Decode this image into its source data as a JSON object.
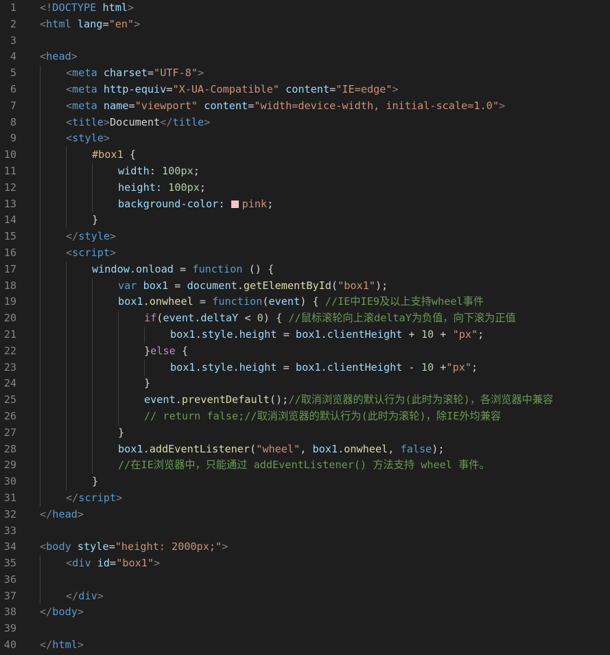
{
  "editor": {
    "background": "#1e1e1e",
    "lines": [
      {
        "n": "1",
        "indent": 0,
        "guides": [],
        "tokens": [
          {
            "t": "<!",
            "c": "punct"
          },
          {
            "t": "DOCTYPE",
            "c": "doctype"
          },
          {
            "t": " html",
            "c": "attr"
          },
          {
            "t": ">",
            "c": "punct"
          }
        ]
      },
      {
        "n": "2",
        "indent": 0,
        "guides": [],
        "tokens": [
          {
            "t": "<",
            "c": "punct"
          },
          {
            "t": "html",
            "c": "tag"
          },
          {
            "t": " lang",
            "c": "attr"
          },
          {
            "t": "=",
            "c": "text"
          },
          {
            "t": "\"en\"",
            "c": "str"
          },
          {
            "t": ">",
            "c": "punct"
          }
        ]
      },
      {
        "n": "3",
        "indent": 0,
        "guides": [],
        "tokens": []
      },
      {
        "n": "4",
        "indent": 0,
        "guides": [],
        "tokens": [
          {
            "t": "<",
            "c": "punct"
          },
          {
            "t": "head",
            "c": "tag"
          },
          {
            "t": ">",
            "c": "punct"
          }
        ]
      },
      {
        "n": "5",
        "indent": 1,
        "guides": [
          0
        ],
        "tokens": [
          {
            "t": "<",
            "c": "punct"
          },
          {
            "t": "meta",
            "c": "tag"
          },
          {
            "t": " charset",
            "c": "attr"
          },
          {
            "t": "=",
            "c": "text"
          },
          {
            "t": "\"UTF-8\"",
            "c": "str"
          },
          {
            "t": ">",
            "c": "punct"
          }
        ]
      },
      {
        "n": "6",
        "indent": 1,
        "guides": [
          0
        ],
        "tokens": [
          {
            "t": "<",
            "c": "punct"
          },
          {
            "t": "meta",
            "c": "tag"
          },
          {
            "t": " http-equiv",
            "c": "attr"
          },
          {
            "t": "=",
            "c": "text"
          },
          {
            "t": "\"X-UA-Compatible\"",
            "c": "str"
          },
          {
            "t": " content",
            "c": "attr"
          },
          {
            "t": "=",
            "c": "text"
          },
          {
            "t": "\"IE=edge\"",
            "c": "str"
          },
          {
            "t": ">",
            "c": "punct"
          }
        ]
      },
      {
        "n": "7",
        "indent": 1,
        "guides": [
          0
        ],
        "tokens": [
          {
            "t": "<",
            "c": "punct"
          },
          {
            "t": "meta",
            "c": "tag"
          },
          {
            "t": " name",
            "c": "attr"
          },
          {
            "t": "=",
            "c": "text"
          },
          {
            "t": "\"viewport\"",
            "c": "str"
          },
          {
            "t": " content",
            "c": "attr"
          },
          {
            "t": "=",
            "c": "text"
          },
          {
            "t": "\"width=device-width, initial-scale=1.0\"",
            "c": "str"
          },
          {
            "t": ">",
            "c": "punct"
          }
        ]
      },
      {
        "n": "8",
        "indent": 1,
        "guides": [
          0
        ],
        "tokens": [
          {
            "t": "<",
            "c": "punct"
          },
          {
            "t": "title",
            "c": "tag"
          },
          {
            "t": ">",
            "c": "punct"
          },
          {
            "t": "Document",
            "c": "text"
          },
          {
            "t": "</",
            "c": "punct"
          },
          {
            "t": "title",
            "c": "tag"
          },
          {
            "t": ">",
            "c": "punct"
          }
        ]
      },
      {
        "n": "9",
        "indent": 1,
        "guides": [
          0
        ],
        "tokens": [
          {
            "t": "<",
            "c": "punct"
          },
          {
            "t": "style",
            "c": "tag"
          },
          {
            "t": ">",
            "c": "punct"
          }
        ]
      },
      {
        "n": "10",
        "indent": 2,
        "guides": [
          0,
          1
        ],
        "tokens": [
          {
            "t": "#box1",
            "c": "sel"
          },
          {
            "t": " {",
            "c": "text"
          }
        ]
      },
      {
        "n": "11",
        "indent": 3,
        "guides": [
          0,
          1,
          2
        ],
        "tokens": [
          {
            "t": "width",
            "c": "prop"
          },
          {
            "t": ": ",
            "c": "text"
          },
          {
            "t": "100px",
            "c": "num"
          },
          {
            "t": ";",
            "c": "text"
          }
        ]
      },
      {
        "n": "12",
        "indent": 3,
        "guides": [
          0,
          1,
          2
        ],
        "tokens": [
          {
            "t": "height",
            "c": "prop"
          },
          {
            "t": ": ",
            "c": "text"
          },
          {
            "t": "100px",
            "c": "num"
          },
          {
            "t": ";",
            "c": "text"
          }
        ]
      },
      {
        "n": "13",
        "indent": 3,
        "guides": [
          0,
          1,
          2
        ],
        "tokens": [
          {
            "t": "background-color",
            "c": "prop"
          },
          {
            "t": ": ",
            "c": "text"
          },
          {
            "t": "",
            "c": "swatch",
            "color": "#ffc0cb"
          },
          {
            "t": "pink",
            "c": "str"
          },
          {
            "t": ";",
            "c": "text"
          }
        ]
      },
      {
        "n": "14",
        "indent": 2,
        "guides": [
          0,
          1
        ],
        "tokens": [
          {
            "t": "}",
            "c": "text"
          }
        ]
      },
      {
        "n": "15",
        "indent": 1,
        "guides": [
          0
        ],
        "tokens": [
          {
            "t": "</",
            "c": "punct"
          },
          {
            "t": "style",
            "c": "tag"
          },
          {
            "t": ">",
            "c": "punct"
          }
        ]
      },
      {
        "n": "16",
        "indent": 1,
        "guides": [
          0
        ],
        "tokens": [
          {
            "t": "<",
            "c": "punct"
          },
          {
            "t": "script",
            "c": "tag"
          },
          {
            "t": ">",
            "c": "punct"
          }
        ]
      },
      {
        "n": "17",
        "indent": 2,
        "guides": [
          0,
          1
        ],
        "tokens": [
          {
            "t": "window",
            "c": "var"
          },
          {
            "t": ".",
            "c": "text"
          },
          {
            "t": "onload",
            "c": "var"
          },
          {
            "t": " = ",
            "c": "text"
          },
          {
            "t": "function",
            "c": "kw"
          },
          {
            "t": " () {",
            "c": "text"
          }
        ]
      },
      {
        "n": "18",
        "indent": 3,
        "guides": [
          0,
          1,
          2
        ],
        "tokens": [
          {
            "t": "var",
            "c": "kw"
          },
          {
            "t": " box1",
            "c": "var"
          },
          {
            "t": " = ",
            "c": "text"
          },
          {
            "t": "document",
            "c": "var"
          },
          {
            "t": ".",
            "c": "text"
          },
          {
            "t": "getElementById",
            "c": "fn"
          },
          {
            "t": "(",
            "c": "text"
          },
          {
            "t": "\"box1\"",
            "c": "str"
          },
          {
            "t": ");",
            "c": "text"
          }
        ]
      },
      {
        "n": "19",
        "indent": 3,
        "guides": [
          0,
          1,
          2
        ],
        "tokens": [
          {
            "t": "box1",
            "c": "var"
          },
          {
            "t": ".",
            "c": "text"
          },
          {
            "t": "onwheel",
            "c": "fn"
          },
          {
            "t": " = ",
            "c": "text"
          },
          {
            "t": "function",
            "c": "kw"
          },
          {
            "t": "(",
            "c": "text"
          },
          {
            "t": "event",
            "c": "var"
          },
          {
            "t": ") { ",
            "c": "text"
          },
          {
            "t": "//IE中IE9及以上支持wheel事件",
            "c": "com"
          }
        ]
      },
      {
        "n": "20",
        "indent": 4,
        "guides": [
          0,
          1,
          2,
          3
        ],
        "tokens": [
          {
            "t": "if",
            "c": "ctl"
          },
          {
            "t": "(",
            "c": "text"
          },
          {
            "t": "event",
            "c": "var"
          },
          {
            "t": ".",
            "c": "text"
          },
          {
            "t": "deltaY",
            "c": "var"
          },
          {
            "t": " < ",
            "c": "text"
          },
          {
            "t": "0",
            "c": "num"
          },
          {
            "t": ") { ",
            "c": "text"
          },
          {
            "t": "//鼠标滚轮向上滚deltaY为负值，向下滚为正值",
            "c": "com"
          }
        ]
      },
      {
        "n": "21",
        "indent": 5,
        "guides": [
          0,
          1,
          2,
          3,
          4
        ],
        "tokens": [
          {
            "t": "box1",
            "c": "var"
          },
          {
            "t": ".",
            "c": "text"
          },
          {
            "t": "style",
            "c": "var"
          },
          {
            "t": ".",
            "c": "text"
          },
          {
            "t": "height",
            "c": "var"
          },
          {
            "t": " = ",
            "c": "text"
          },
          {
            "t": "box1",
            "c": "var"
          },
          {
            "t": ".",
            "c": "text"
          },
          {
            "t": "clientHeight",
            "c": "var"
          },
          {
            "t": " + ",
            "c": "text"
          },
          {
            "t": "10",
            "c": "num"
          },
          {
            "t": " + ",
            "c": "text"
          },
          {
            "t": "\"px\"",
            "c": "str"
          },
          {
            "t": ";",
            "c": "text"
          }
        ]
      },
      {
        "n": "22",
        "indent": 4,
        "guides": [
          0,
          1,
          2,
          3
        ],
        "tokens": [
          {
            "t": "}",
            "c": "text"
          },
          {
            "t": "else",
            "c": "ctl"
          },
          {
            "t": " {",
            "c": "text"
          }
        ]
      },
      {
        "n": "23",
        "indent": 5,
        "guides": [
          0,
          1,
          2,
          3,
          4
        ],
        "tokens": [
          {
            "t": "box1",
            "c": "var"
          },
          {
            "t": ".",
            "c": "text"
          },
          {
            "t": "style",
            "c": "var"
          },
          {
            "t": ".",
            "c": "text"
          },
          {
            "t": "height",
            "c": "var"
          },
          {
            "t": " = ",
            "c": "text"
          },
          {
            "t": "box1",
            "c": "var"
          },
          {
            "t": ".",
            "c": "text"
          },
          {
            "t": "clientHeight",
            "c": "var"
          },
          {
            "t": " - ",
            "c": "text"
          },
          {
            "t": "10",
            "c": "num"
          },
          {
            "t": " +",
            "c": "text"
          },
          {
            "t": "\"px\"",
            "c": "str"
          },
          {
            "t": ";",
            "c": "text"
          }
        ]
      },
      {
        "n": "24",
        "indent": 4,
        "guides": [
          0,
          1,
          2,
          3
        ],
        "tokens": [
          {
            "t": "}",
            "c": "text"
          }
        ]
      },
      {
        "n": "25",
        "indent": 4,
        "guides": [
          0,
          1,
          2,
          3
        ],
        "tokens": [
          {
            "t": "event",
            "c": "var"
          },
          {
            "t": ".",
            "c": "text"
          },
          {
            "t": "preventDefault",
            "c": "fn"
          },
          {
            "t": "();",
            "c": "text"
          },
          {
            "t": "//取消浏览器的默认行为(此时为滚轮)，各浏览器中兼容",
            "c": "com"
          }
        ]
      },
      {
        "n": "26",
        "indent": 4,
        "guides": [
          0,
          1,
          2,
          3
        ],
        "tokens": [
          {
            "t": "// return false;//取消浏览器的默认行为(此时为滚轮)，除IE外均兼容",
            "c": "com"
          }
        ]
      },
      {
        "n": "27",
        "indent": 3,
        "guides": [
          0,
          1,
          2
        ],
        "tokens": [
          {
            "t": "}",
            "c": "text"
          }
        ]
      },
      {
        "n": "28",
        "indent": 3,
        "guides": [
          0,
          1,
          2
        ],
        "tokens": [
          {
            "t": "box1",
            "c": "var"
          },
          {
            "t": ".",
            "c": "text"
          },
          {
            "t": "addEventListener",
            "c": "fn"
          },
          {
            "t": "(",
            "c": "text"
          },
          {
            "t": "\"wheel\"",
            "c": "str"
          },
          {
            "t": ", ",
            "c": "text"
          },
          {
            "t": "box1",
            "c": "var"
          },
          {
            "t": ".",
            "c": "text"
          },
          {
            "t": "onwheel",
            "c": "fn"
          },
          {
            "t": ", ",
            "c": "text"
          },
          {
            "t": "false",
            "c": "kw"
          },
          {
            "t": ");",
            "c": "text"
          }
        ]
      },
      {
        "n": "29",
        "indent": 3,
        "guides": [
          0,
          1,
          2
        ],
        "tokens": [
          {
            "t": "//在IE浏览器中，只能通过 addEventListener() 方法支持 wheel 事件。",
            "c": "com"
          }
        ]
      },
      {
        "n": "30",
        "indent": 2,
        "guides": [
          0,
          1
        ],
        "tokens": [
          {
            "t": "}",
            "c": "text"
          }
        ]
      },
      {
        "n": "31",
        "indent": 1,
        "guides": [
          0
        ],
        "tokens": [
          {
            "t": "</",
            "c": "punct"
          },
          {
            "t": "script",
            "c": "tag"
          },
          {
            "t": ">",
            "c": "punct"
          }
        ]
      },
      {
        "n": "32",
        "indent": 0,
        "guides": [],
        "tokens": [
          {
            "t": "</",
            "c": "punct"
          },
          {
            "t": "head",
            "c": "tag"
          },
          {
            "t": ">",
            "c": "punct"
          }
        ]
      },
      {
        "n": "33",
        "indent": 0,
        "guides": [],
        "tokens": []
      },
      {
        "n": "34",
        "indent": 0,
        "guides": [],
        "tokens": [
          {
            "t": "<",
            "c": "punct"
          },
          {
            "t": "body",
            "c": "tag"
          },
          {
            "t": " style",
            "c": "attr"
          },
          {
            "t": "=",
            "c": "text"
          },
          {
            "t": "\"height: 2000px;\"",
            "c": "str"
          },
          {
            "t": ">",
            "c": "punct"
          }
        ]
      },
      {
        "n": "35",
        "indent": 1,
        "guides": [
          0
        ],
        "tokens": [
          {
            "t": "<",
            "c": "punct"
          },
          {
            "t": "div",
            "c": "tag"
          },
          {
            "t": " id",
            "c": "attr"
          },
          {
            "t": "=",
            "c": "text"
          },
          {
            "t": "\"box1\"",
            "c": "str"
          },
          {
            "t": ">",
            "c": "punct"
          }
        ]
      },
      {
        "n": "36",
        "indent": 1,
        "guides": [
          0
        ],
        "tokens": []
      },
      {
        "n": "37",
        "indent": 1,
        "guides": [
          0
        ],
        "tokens": [
          {
            "t": "</",
            "c": "punct"
          },
          {
            "t": "div",
            "c": "tag"
          },
          {
            "t": ">",
            "c": "punct"
          }
        ]
      },
      {
        "n": "38",
        "indent": 0,
        "guides": [],
        "tokens": [
          {
            "t": "</",
            "c": "punct"
          },
          {
            "t": "body",
            "c": "tag"
          },
          {
            "t": ">",
            "c": "punct"
          }
        ]
      },
      {
        "n": "39",
        "indent": 0,
        "guides": [],
        "tokens": []
      },
      {
        "n": "40",
        "indent": 0,
        "guides": [],
        "tokens": [
          {
            "t": "</",
            "c": "punct"
          },
          {
            "t": "html",
            "c": "tag"
          },
          {
            "t": ">",
            "c": "punct"
          }
        ]
      }
    ]
  }
}
